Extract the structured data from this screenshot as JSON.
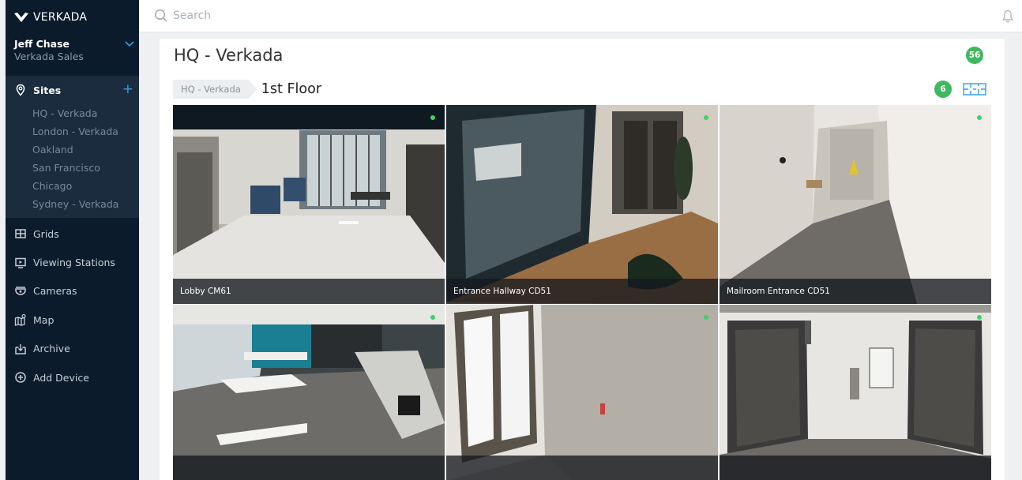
{
  "brand": {
    "name": "VERKADA"
  },
  "user": {
    "name": "Jeff Chase",
    "org": "Verkada Sales"
  },
  "sidebar": {
    "sites_label": "Sites",
    "sites": [
      "HQ - Verkada",
      "London - Verkada",
      "Oakland",
      "San Francisco",
      "Chicago",
      "Sydney - Verkada"
    ],
    "nav": [
      {
        "label": "Grids",
        "icon": "grid-icon"
      },
      {
        "label": "Viewing Stations",
        "icon": "monitor-icon"
      },
      {
        "label": "Cameras",
        "icon": "camera-icon"
      },
      {
        "label": "Map",
        "icon": "map-icon"
      },
      {
        "label": "Archive",
        "icon": "archive-icon"
      },
      {
        "label": "Add Device",
        "icon": "add-circle-icon"
      }
    ]
  },
  "search": {
    "placeholder": "Search"
  },
  "main": {
    "title": "HQ - Verkada",
    "total_cameras": "56",
    "breadcrumb": {
      "site": "HQ - Verkada",
      "floor": "1st Floor"
    },
    "floor_cameras": "6"
  },
  "cameras": [
    {
      "name": "Lobby CM61",
      "online": true
    },
    {
      "name": "Entrance Hallway CD51",
      "online": true
    },
    {
      "name": "Mailroom Entrance CD51",
      "online": true
    },
    {
      "name": "",
      "online": true
    },
    {
      "name": "",
      "online": true
    },
    {
      "name": "",
      "online": true
    }
  ],
  "colors": {
    "sidebar_bg": "#0c1b2b",
    "accent_blue": "#2f9ee8",
    "badge_green": "#3fb95f"
  }
}
